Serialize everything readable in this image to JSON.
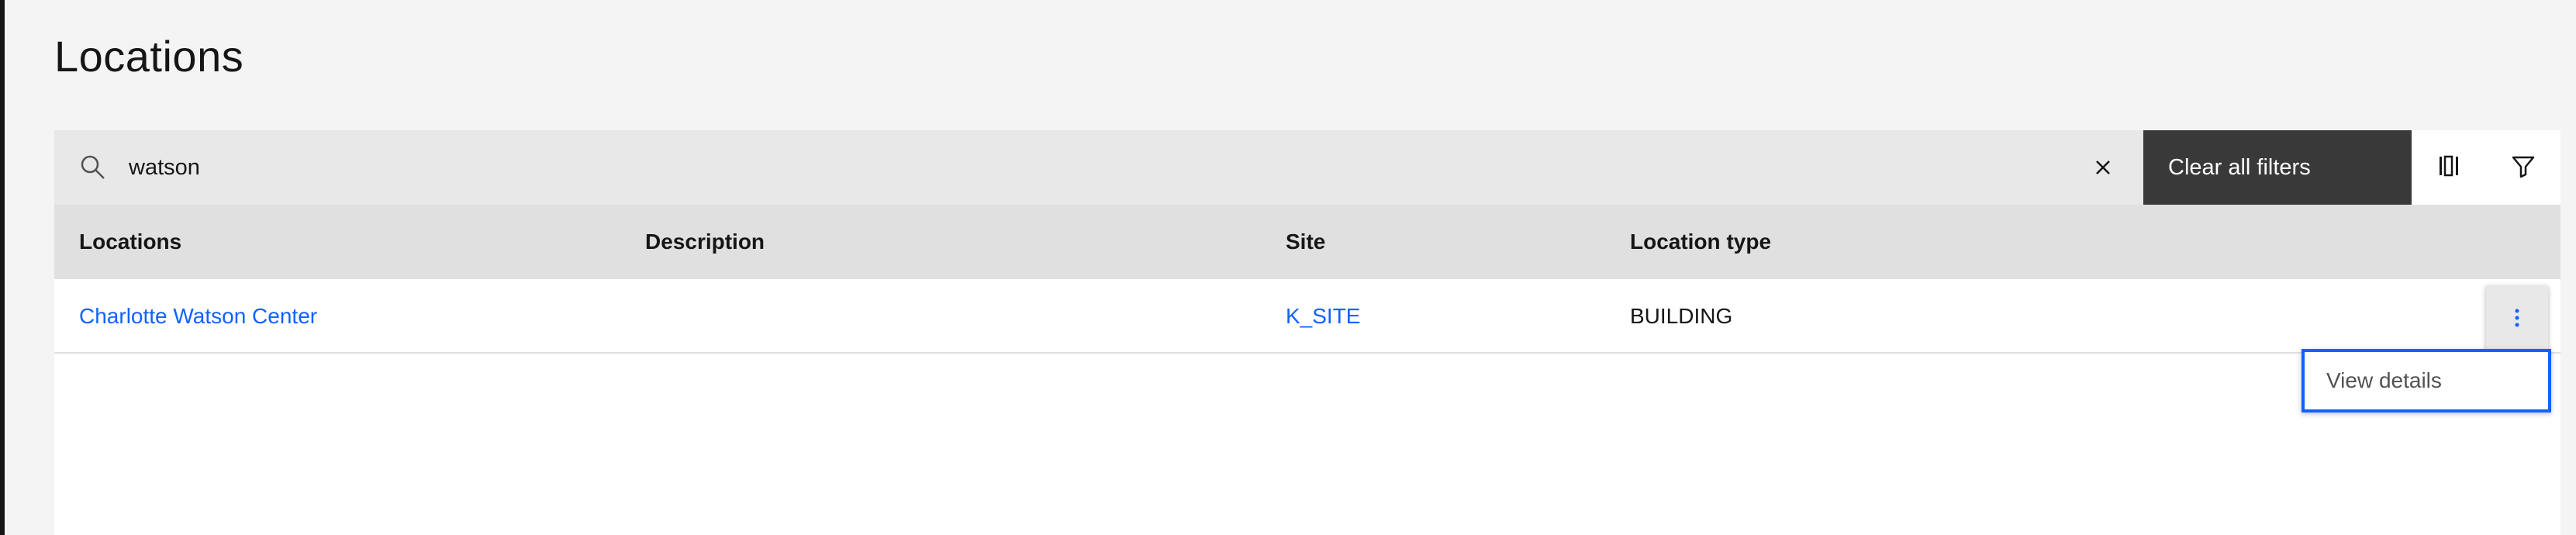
{
  "page": {
    "title": "Locations"
  },
  "search": {
    "value": "watson",
    "placeholder": ""
  },
  "toolbar": {
    "clear_filters_label": "Clear all filters"
  },
  "table": {
    "columns": [
      "Locations",
      "Description",
      "Site",
      "Location type"
    ],
    "rows": [
      {
        "location": "Charlotte Watson Center",
        "description": "",
        "site": "K_SITE",
        "location_type": "BUILDING"
      }
    ]
  },
  "row_menu": {
    "items": [
      "View details"
    ]
  },
  "icons": [
    "search-icon",
    "close-icon",
    "column-settings-icon",
    "filter-icon",
    "overflow-menu-icon"
  ],
  "colors": {
    "accent": "#0f62fe",
    "dark_button": "#393939",
    "background": "#f4f4f4"
  }
}
